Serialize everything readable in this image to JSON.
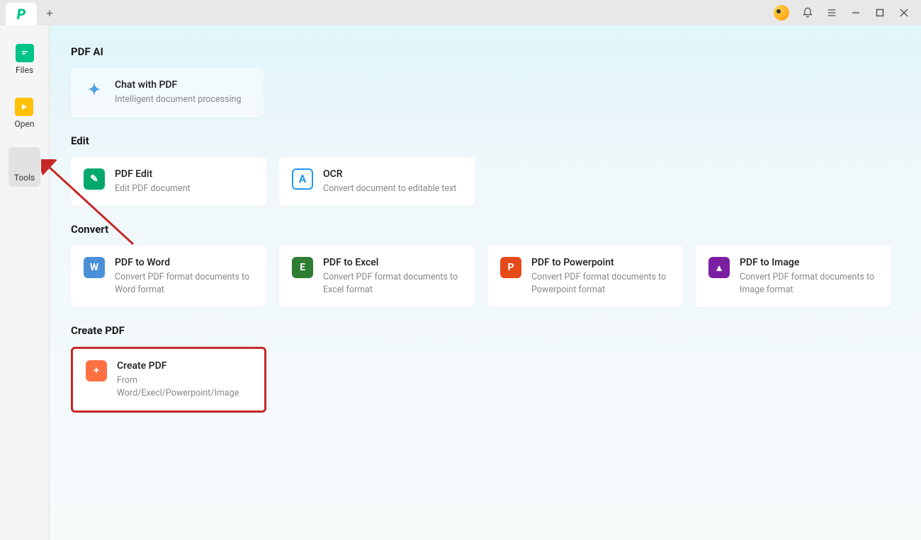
{
  "titlebar": {
    "new_tab_label": "+"
  },
  "sidebar": {
    "items": [
      {
        "label": "Files"
      },
      {
        "label": "Open"
      },
      {
        "label": "Tools"
      }
    ]
  },
  "sections": {
    "pdf_ai": {
      "heading": "PDF AI",
      "card": {
        "title": "Chat with PDF",
        "desc": "Intelligent document processing"
      }
    },
    "edit": {
      "heading": "Edit",
      "cards": [
        {
          "title": "PDF Edit",
          "desc": "Edit PDF document"
        },
        {
          "title": "OCR",
          "desc": "Convert document to editable text"
        }
      ]
    },
    "convert": {
      "heading": "Convert",
      "cards": [
        {
          "title": "PDF to Word",
          "desc": "Convert PDF format documents to Word format"
        },
        {
          "title": "PDF to Excel",
          "desc": "Convert PDF format documents to Excel format"
        },
        {
          "title": "PDF to Powerpoint",
          "desc": "Convert PDF format documents to Powerpoint format"
        },
        {
          "title": "PDF to Image",
          "desc": "Convert PDF format documents to Image format"
        }
      ]
    },
    "create": {
      "heading": "Create PDF",
      "card": {
        "title": "Create PDF",
        "desc": "From Word/Execl/Powerpoint/Image"
      }
    }
  }
}
